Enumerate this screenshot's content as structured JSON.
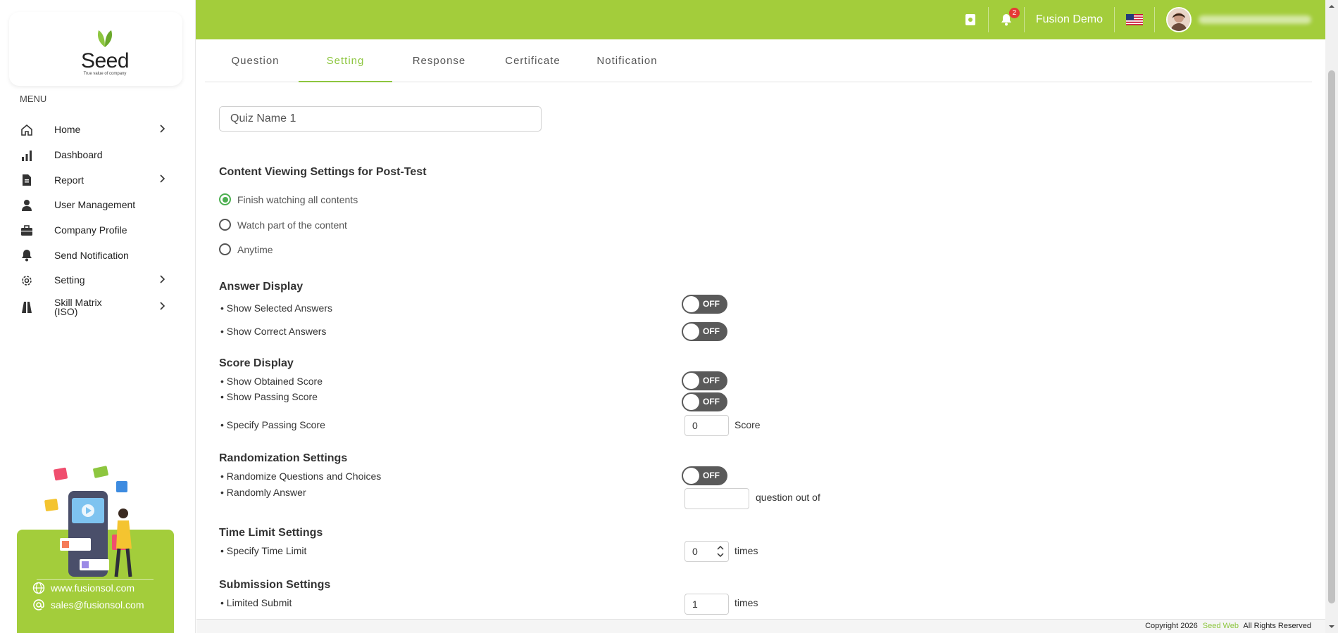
{
  "topbar": {
    "notification_count": "2",
    "user_name": "Fusion Demo"
  },
  "logo": {
    "word": "Seed",
    "tagline": "True value of company"
  },
  "sidebar": {
    "menu_label": "MENU",
    "items": [
      {
        "label": "Home",
        "icon": "home-icon",
        "has_chevron": true
      },
      {
        "label": "Dashboard",
        "icon": "bar-chart-icon",
        "has_chevron": false
      },
      {
        "label": "Report",
        "icon": "document-icon",
        "has_chevron": true
      },
      {
        "label": "User Management",
        "icon": "person-icon",
        "has_chevron": false
      },
      {
        "label": "Company Profile",
        "icon": "briefcase-icon",
        "has_chevron": false
      },
      {
        "label": "Send Notification",
        "icon": "bell-icon",
        "has_chevron": false
      },
      {
        "label": "Setting",
        "icon": "gear-icon",
        "has_chevron": true
      },
      {
        "label": "Skill Matrix\n(ISO)",
        "icon": "road-icon",
        "has_chevron": true
      }
    ],
    "promo": {
      "website": "www.fusionsol.com",
      "email": "sales@fusionsol.com"
    }
  },
  "tabs": [
    {
      "label": "Question",
      "active": false
    },
    {
      "label": "Setting",
      "active": true
    },
    {
      "label": "Response",
      "active": false
    },
    {
      "label": "Certificate",
      "active": false
    },
    {
      "label": "Notification",
      "active": false
    }
  ],
  "form": {
    "quiz_name": "Quiz Name 1",
    "content_viewing": {
      "title": "Content Viewing Settings for Post-Test",
      "options": [
        "Finish watching all contents",
        "Watch part of the content",
        "Anytime"
      ],
      "selected": "Finish watching all contents"
    },
    "answer_display": {
      "title": "Answer Display",
      "show_selected": {
        "label": "• Show Selected Answers",
        "state": "OFF"
      },
      "show_correct": {
        "label": "• Show Correct Answers",
        "state": "OFF"
      }
    },
    "score_display": {
      "title": "Score Display",
      "show_obtained": {
        "label": "• Show Obtained Score",
        "state": "OFF"
      },
      "show_passing": {
        "label": "• Show Passing Score",
        "state": "OFF"
      },
      "specify_passing": {
        "label": "• Specify Passing Score",
        "value": "0",
        "suffix": "Score"
      }
    },
    "randomization": {
      "title": "Randomization Settings",
      "randomize_questions": {
        "label": "• Randomize Questions and Choices",
        "state": "OFF"
      },
      "randomly_answer": {
        "label": "• Randomly Answer",
        "value": "",
        "suffix": "question out of"
      }
    },
    "time_limit": {
      "title": "Time Limit Settings",
      "specify": {
        "label": "• Specify Time Limit",
        "value": "0",
        "suffix": "times"
      }
    },
    "submission": {
      "title": "Submission Settings",
      "limited": {
        "label": "• Limited Submit",
        "value": "1",
        "suffix": "times"
      }
    }
  },
  "footer": {
    "prefix": "Copyright 2026",
    "brand": "Seed Web",
    "suffix": "All Rights Reserved"
  },
  "colors": {
    "accent": "#a3cd3b",
    "active_tab": "#8dc63f",
    "radio_checked": "#4caf50",
    "toggle_off": "#5a5a5a"
  }
}
